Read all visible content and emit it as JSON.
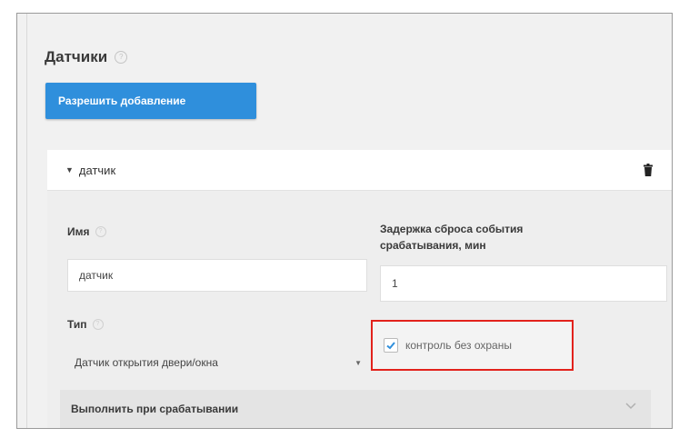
{
  "section": {
    "title": "Датчики",
    "allow_button": "Разрешить добавление"
  },
  "sensor": {
    "header_title": "датчик",
    "name_label": "Имя",
    "name_value": "датчик",
    "delay_label_line1": "Задержка сброса события",
    "delay_label_line2": "срабатывания, мин",
    "delay_value": "1",
    "type_label": "Тип",
    "type_value": "Датчик открытия двери/окна",
    "control_label": "контроль без охраны",
    "control_checked": true,
    "on_trigger_label": "Выполнить при срабатывании"
  },
  "colors": {
    "accent": "#2f8fdc",
    "highlight": "#e2221c"
  },
  "icons": {
    "help": "help-circle-icon",
    "trash": "trash-icon",
    "caret": "caret-down-icon",
    "chevron": "chevron-down-icon",
    "check": "checkmark-icon"
  }
}
